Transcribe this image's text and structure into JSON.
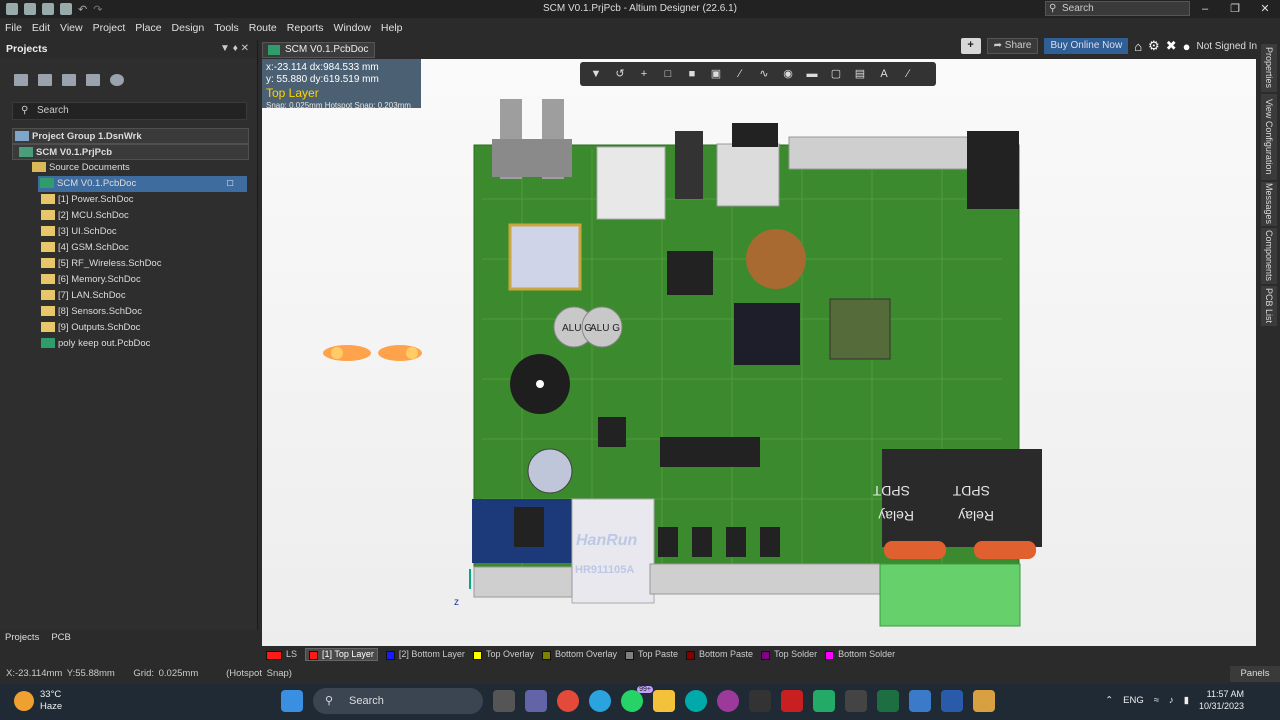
{
  "window": {
    "title": "SCM V0.1.PrjPcb - Altium Designer (22.6.1)",
    "search_placeholder": "Search"
  },
  "menu": [
    "File",
    "Edit",
    "View",
    "Project",
    "Place",
    "Design",
    "Tools",
    "Route",
    "Reports",
    "Window",
    "Help"
  ],
  "header": {
    "share": "Share",
    "buy": "Buy Online Now",
    "signin": "Not Signed In"
  },
  "projects_panel": {
    "title": "Projects",
    "search_placeholder": "Search",
    "group": "Project Group 1.DsnWrk",
    "project": "SCM V0.1.PrjPcb",
    "folder": "Source Documents",
    "docs": [
      "SCM V0.1.PcbDoc",
      "[1] Power.SchDoc",
      "[2] MCU.SchDoc",
      "[3] UI.SchDoc",
      "[4] GSM.SchDoc",
      "[5] RF_Wireless.SchDoc",
      "[6] Memory.SchDoc",
      "[7] LAN.SchDoc",
      "[8] Sensors.SchDoc",
      "[9] Outputs.SchDoc",
      "poly keep out.PcbDoc"
    ],
    "tabs": [
      "Projects",
      "PCB"
    ]
  },
  "doc_tab": "SCM V0.1.PcbDoc",
  "hud": {
    "line1": "x:-23.114   dx:984.533 mm",
    "line2": "y: 55.880   dy:619.519 mm",
    "layer": "Top Layer",
    "snap": "Snap: 0.025mm Hotspot Snap: 0.203mm"
  },
  "board_labels": {
    "hanrun": "HanRun",
    "hanrun_part": "HR911105A",
    "relay": "Relay",
    "spdt": "SPDT",
    "cap": "ALU G",
    "axis_z": "z"
  },
  "right_tabs": [
    "Properties",
    "View Configuration",
    "Messages",
    "Components",
    "PCB List"
  ],
  "layers": [
    {
      "name": "LS",
      "color": "#ff1a1a"
    },
    {
      "name": "[1] Top Layer",
      "color": "#ff1a1a",
      "active": true
    },
    {
      "name": "[2] Bottom Layer",
      "color": "#1a1aff"
    },
    {
      "name": "Top Overlay",
      "color": "#ffff00"
    },
    {
      "name": "Bottom Overlay",
      "color": "#808000"
    },
    {
      "name": "Top Paste",
      "color": "#808080"
    },
    {
      "name": "Bottom Paste",
      "color": "#800000"
    },
    {
      "name": "Top Solder",
      "color": "#800080"
    },
    {
      "name": "Bottom Solder",
      "color": "#ff00ff"
    }
  ],
  "panels_button": "Panels",
  "status": {
    "coords": "X:-23.114mm Y:55.88mm",
    "grid": "Grid: 0.025mm",
    "snap": "(Hotspot Snap)"
  },
  "taskbar": {
    "temp": "33°C",
    "weather": "Haze",
    "search": "Search",
    "time": "11:57 AM",
    "date": "10/31/2023",
    "badge": "99+",
    "lang": "ENG"
  }
}
